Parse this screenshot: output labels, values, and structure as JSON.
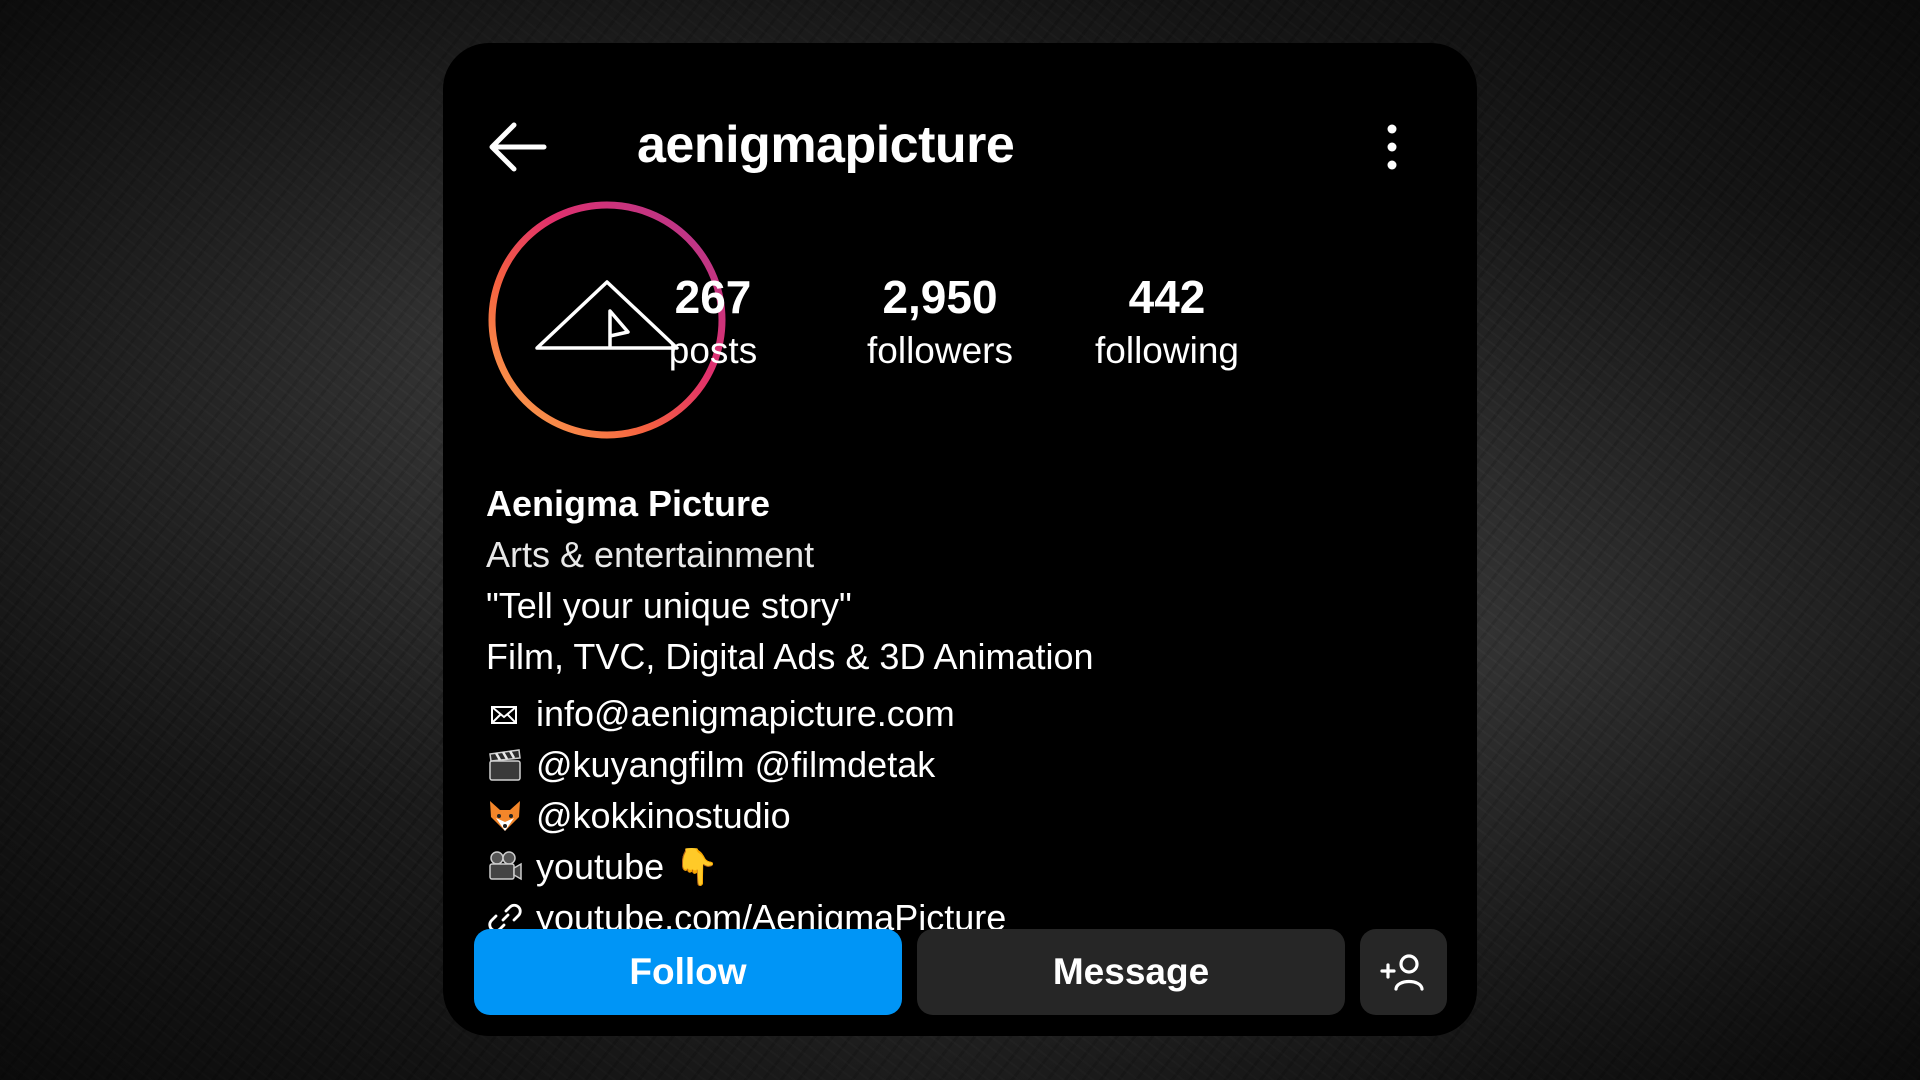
{
  "header": {
    "username": "aenigmapicture",
    "back_icon": "arrow-left-icon",
    "more_icon": "more-vertical-icon"
  },
  "profile": {
    "avatar_ring_colors": [
      "#f58529",
      "#dd2a7b",
      "#c13584",
      "#833ab4"
    ],
    "stats": {
      "posts": {
        "value": "267",
        "label": "posts"
      },
      "followers": {
        "value": "2,950",
        "label": "followers"
      },
      "following": {
        "value": "442",
        "label": "following"
      }
    },
    "name": "Aenigma Picture",
    "category": "Arts & entertainment",
    "bio_lines": [
      "\"Tell your unique story\"",
      "Film, TVC, Digital Ads & 3D Animation"
    ],
    "contact_rows": [
      {
        "icon": "envelope-icon",
        "text": "info@aenigmapicture.com"
      },
      {
        "icon": "clapperboard-icon",
        "text": "@kuyangfilm @filmdetak"
      },
      {
        "icon": "fox-icon",
        "text": "@kokkinostudio"
      },
      {
        "icon": "movie-camera-icon",
        "text": "youtube 👇"
      }
    ],
    "link": {
      "icon": "link-icon",
      "text": "youtube.com/AenigmaPicture"
    }
  },
  "actions": {
    "follow_label": "Follow",
    "message_label": "Message",
    "add_user_icon": "add-user-icon"
  },
  "colors": {
    "follow_button": "#0095f6",
    "secondary_button": "#262626",
    "card_background": "#000000"
  }
}
